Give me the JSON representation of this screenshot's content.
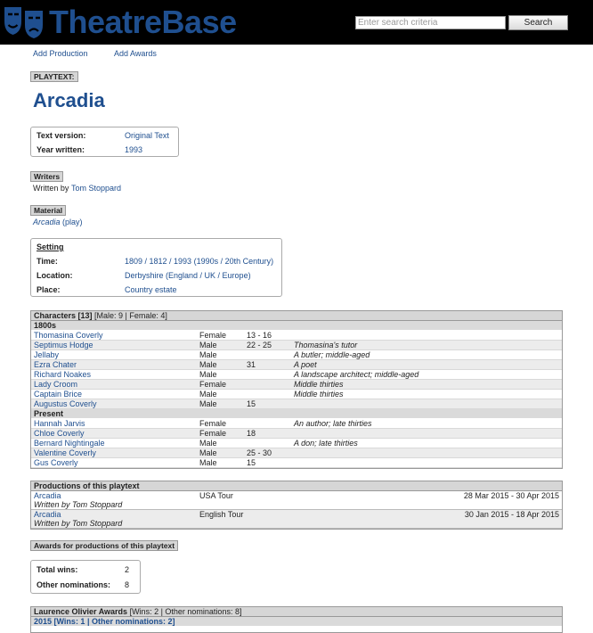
{
  "header": {
    "logo_text": "TheatreBase",
    "search": {
      "placeholder": "Enter search criteria",
      "button": "Search"
    }
  },
  "nav": {
    "add_production": "Add Production",
    "add_awards": "Add Awards"
  },
  "playtext_label": "PLAYTEXT:",
  "title": "Arcadia",
  "info": {
    "text_version_label": "Text version:",
    "text_version": "Original Text",
    "year_label": "Year written:",
    "year": "1993"
  },
  "writers": {
    "label": "Writers",
    "prefix": "Written by",
    "name": "Tom Stoppard"
  },
  "material": {
    "label": "Material",
    "title": "Arcadia",
    "suffix": "(play)"
  },
  "setting": {
    "label": "Setting",
    "time_label": "Time:",
    "time": "1809 / 1812 / 1993 (1990s / 20th Century)",
    "location_label": "Location:",
    "location": "Derbyshire (England / UK / Europe)",
    "place_label": "Place:",
    "place": "Country estate"
  },
  "characters": {
    "heading": "Characters [13]",
    "counts": "[Male: 9 | Female: 4]",
    "groups": [
      {
        "label": "1800s",
        "rows": [
          {
            "name": "Thomasina Coverly",
            "gender": "Female",
            "age": "13 - 16",
            "desc": ""
          },
          {
            "name": "Septimus Hodge",
            "gender": "Male",
            "age": "22 - 25",
            "desc": "Thomasina's tutor"
          },
          {
            "name": "Jellaby",
            "gender": "Male",
            "age": "",
            "desc": "A butler; middle-aged"
          },
          {
            "name": "Ezra Chater",
            "gender": "Male",
            "age": "31",
            "desc": "A poet"
          },
          {
            "name": "Richard Noakes",
            "gender": "Male",
            "age": "",
            "desc": "A landscape architect; middle-aged"
          },
          {
            "name": "Lady Croom",
            "gender": "Female",
            "age": "",
            "desc": "Middle thirties"
          },
          {
            "name": "Captain Brice",
            "gender": "Male",
            "age": "",
            "desc": "Middle thirties"
          },
          {
            "name": "Augustus Coverly",
            "gender": "Male",
            "age": "15",
            "desc": ""
          }
        ]
      },
      {
        "label": "Present",
        "rows": [
          {
            "name": "Hannah Jarvis",
            "gender": "Female",
            "age": "",
            "desc": "An author; late thirties"
          },
          {
            "name": "Chloe Coverly",
            "gender": "Female",
            "age": "18",
            "desc": ""
          },
          {
            "name": "Bernard Nightingale",
            "gender": "Male",
            "age": "",
            "desc": "A don; late thirties"
          },
          {
            "name": "Valentine Coverly",
            "gender": "Male",
            "age": "25 - 30",
            "desc": ""
          },
          {
            "name": "Gus Coverly",
            "gender": "Male",
            "age": "15",
            "desc": ""
          }
        ]
      }
    ]
  },
  "productions": {
    "heading": "Productions of this playtext",
    "rows": [
      {
        "title": "Arcadia",
        "written_by": "Written by Tom Stoppard",
        "tour": "USA Tour",
        "dates": "28 Mar 2015 - 30 Apr 2015"
      },
      {
        "title": "Arcadia",
        "written_by": "Written by Tom Stoppard",
        "tour": "English Tour",
        "dates": "30 Jan 2015 - 18 Apr 2015"
      }
    ]
  },
  "awards": {
    "label": "Awards for productions of this playtext",
    "total_wins_label": "Total wins:",
    "total_wins": "2",
    "other_nominations_label": "Other nominations:",
    "other_nominations": "8"
  },
  "olivier": {
    "heading": "Laurence Olivier Awards",
    "counts": "[Wins: 2 | Other nominations: 8]",
    "year_row": "2015 [Wins: 1 | Other nominations: 2]"
  },
  "colors": {
    "link": "#1f4f8f",
    "header_bg": "#000000",
    "panel_head": "#d6d6d6"
  }
}
